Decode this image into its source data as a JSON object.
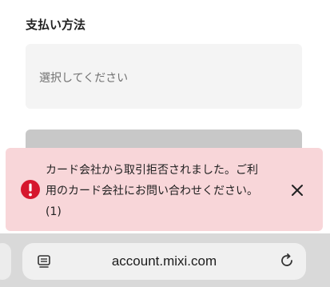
{
  "form": {
    "section_label": "支払い方法",
    "select_placeholder": "選択してください",
    "submit_label": ""
  },
  "toast": {
    "message_line1": "カード会社から取引拒否されました。ご利",
    "message_line2": "用のカード会社にお問い合わせください。",
    "message_line3": "(1)",
    "icon": "error-circle-icon",
    "close_icon": "close-icon"
  },
  "browser": {
    "url": "account.mixi.com",
    "reader_icon": "reader-mode-icon",
    "reload_icon": "reload-icon"
  },
  "colors": {
    "toast_bg": "#f8d6d9",
    "error_red": "#d6172d",
    "field_bg": "#f4f4f4",
    "disabled_button": "#c8c8c8",
    "toolbar_bg": "#d9d9d9"
  }
}
